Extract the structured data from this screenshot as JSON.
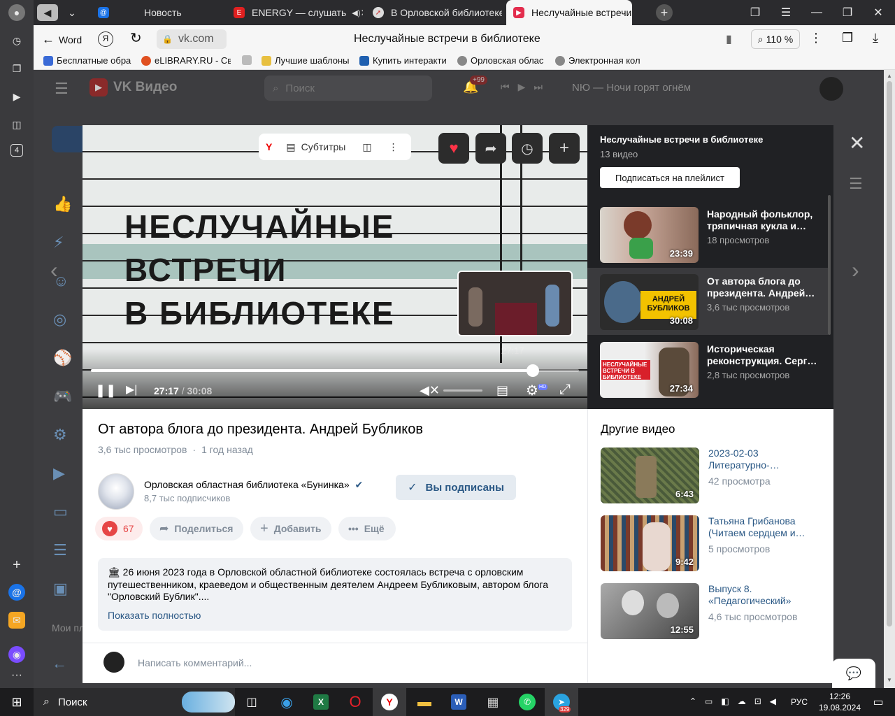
{
  "tabs": [
    {
      "label": "Новость"
    },
    {
      "label": "ENERGY — слушать"
    },
    {
      "label": "В Орловской библиотеке"
    },
    {
      "label": "Неслучайные встречи в"
    }
  ],
  "toolbar": {
    "back_label": "Word",
    "url": "vk.com",
    "page_title": "Неслучайные встречи в библиотеке",
    "zoom": "110 %"
  },
  "bookmarks": [
    "Бесплатные обра",
    "eLIBRARY.RU - Св",
    "Лучшие шаблоны",
    "Купить интеракти",
    "Орловская облас",
    "Электронная кол"
  ],
  "sidebar": {
    "badge_count": "4"
  },
  "vk_header": {
    "logo": "VK Видео",
    "search_placeholder": "Поиск",
    "notif_count": "+99",
    "now_playing": "NЮ — Ночи горят огнём",
    "bg_menu_label": "Мои пл"
  },
  "player": {
    "subtitles_label": "Субтитры",
    "title_lines": [
      "НЕСЛУЧАЙНЫЕ",
      "ВСТРЕЧИ",
      "В БИБЛИОТЕКЕ"
    ],
    "preview_time": "27:17",
    "current_time": "27:17",
    "separator": "/",
    "duration": "30:08",
    "hd_badge": "HD",
    "progress": 0.905
  },
  "playlist": {
    "title": "Неслучайные встречи в библиотеке",
    "count": "13 видео",
    "subscribe_label": "Подписаться на плейлист",
    "items": [
      {
        "title": "Народный фольклор, тряпичная кукла и…",
        "views": "18 просмотров",
        "duration": "23:39"
      },
      {
        "title": "От автора блога до президента. Андрей…",
        "views": "3,6 тыс просмотров",
        "duration": "30:08",
        "thumb_text": "АНДРЕЙ БУБЛИКОВ"
      },
      {
        "title": "Историческая реконструкция. Серг…",
        "views": "2,8 тыс просмотров",
        "duration": "27:34",
        "thumb_text": "НЕСЛУЧАЙНЫЕ ВСТРЕЧИ В БИБЛИОТЕКЕ"
      }
    ]
  },
  "video_info": {
    "title": "От автора блога до президента. Андрей Бубликов",
    "views": "3,6 тыс просмотров",
    "dot": "·",
    "date": "1 год назад",
    "channel_name": "Орловская областная библиотека «Бунинка»",
    "subscribers": "8,7 тыс подписчиков",
    "subscribed_label": "Вы подписаны",
    "likes": "67",
    "share_label": "Поделиться",
    "add_label": "Добавить",
    "more_label": "Ещё",
    "description": "🏛 26 июня 2023 года в Орловской областной библиотеке состоялась встреча с орловским путешественником, краеведом и общественным деятелем Андреем Бубликовым, автором блога \"Орловский Бублик\"....",
    "show_more": "Показать полностью",
    "comment_placeholder": "Написать комментарий..."
  },
  "other_videos": {
    "title": "Другие видео",
    "items": [
      {
        "title": "2023-02-03 Литературно-…",
        "views": "42 просмотра",
        "duration": "6:43"
      },
      {
        "title": "Татьяна Грибанова (Читаем сердцем и…",
        "views": "5 просмотров",
        "duration": "9:42"
      },
      {
        "title": "Выпуск 8. «Педагогический»",
        "views": "4,6 тыс просмотров",
        "duration": "12:55"
      }
    ]
  },
  "taskbar": {
    "search_label": "Поиск",
    "lang": "РУС",
    "time": "12:26",
    "date": "19.08.2024",
    "telegram_badge": "329"
  },
  "colors": {
    "vk_blue": "#2a5885",
    "like_red": "#e64646",
    "player_bg": "#202124"
  }
}
